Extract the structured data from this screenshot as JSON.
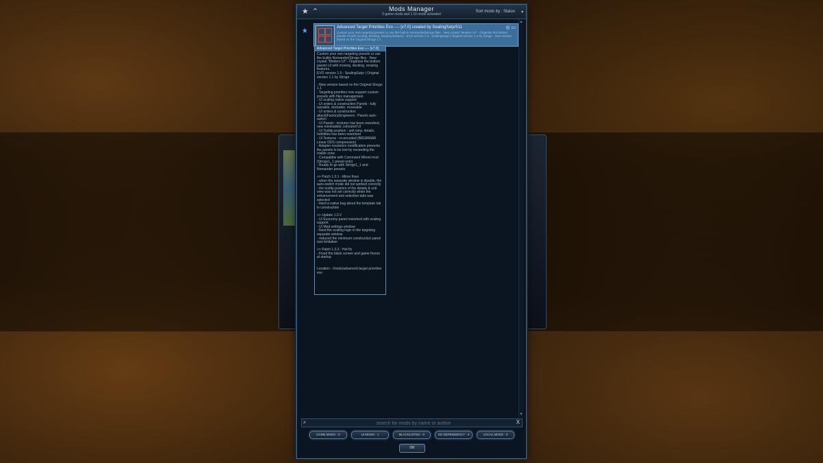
{
  "header": {
    "title": "Mods Manager",
    "subtitle": "0 game mods and 1 UI mods activated",
    "sort_label": "Sort mods by : Status",
    "sort_arrow": "▾"
  },
  "icons": {
    "favorite": "★",
    "collapse": "⌃",
    "row_favorite": "★",
    "globe": "◎",
    "monitor": "▭",
    "search": "⌕",
    "clear": "X",
    "scroll_up": "▲",
    "scroll_down": "▼"
  },
  "mods": [
    {
      "name": "Advanced Target Priorities Evo ---- [v7.0] created by SealingSatyr511",
      "description": "Custom your own targeting presets or use the built-in Nomander|Strogo files - New crystal \"Modern UI\" - Organise the bottom panels UI with moving, docking, resizing features - EVO version 1.0 - SealingSatyr | Original version 1.1 by Strogo - new version based on the Original Strogo 1.1"
    }
  ],
  "tooltip": {
    "title": "Advanced Target Priorities Evo ---- [v7.0]",
    "body": "Custom your own targeting presets or use the builtin Nomander|Strogo files - New crystal \"Modern UI\" - Organise the bottom panels UI with moving, docking, resizing features.\nEVO version 1.0 - SealingSatyr | Original version 1.1 by Strogo\n\n- New version based on the Original Strogo 1.1\n- Targeting priorities now support custom presets with files management\n- UI scaling native support\n- UI orders & construction Panels : fully sizeable, dockable, moveable\n- UI orders & construction attack|Factory|Engineers : Panels auto-switch\n- UI Panels : textures has been reworked, new minimalistic colorized UI\n- UI Tooltip position : unit view, details, hotbitties has been reworked\n- UI Textures : re-encoded (B8G8R8A8 Linear DDS compression)\n- Adapter resolution modification prevents the panels to be lost by exceeding the visible zone\n- Compatible with Command Wheel mod (Strogo1_1 preset only)\n- Ready to go with Strogo1_1 and Nomander presets\n\n>> Patch 1.0.1 - Minor fixes\n- when the separate window is disable, the auto-switch mode did not worked correctly\n- the tooltip position of the details & unit view was not set correctly when the enhancement and selection tabs was selected\n- fixed a native bug about the template tab in construction\n\n>> Update 1.0.2\n- UI Economy panel reworked with scaling support\n- UI Mod settings window\n- fixed the scaling logic in the targeting separate window\n- reduced the minimum construction panel size limitation\n\n>> Patch 1.0.3 - Hot fix\n- Fixed the black screen and game freeze at startup\n\n\nLocation : /mods/advanced target priorities evo"
  },
  "search": {
    "placeholder": "search for mods by name or author",
    "value": ""
  },
  "filters": [
    "GAME MODS - 0",
    "UI MODS - 1",
    "BLACKLISTED - 0",
    "NO DEPENDENCY - 0",
    "LOCAL MODS - 0"
  ],
  "ok_label": "OK",
  "colors": {
    "selected_row": "#3c6e9c",
    "accent": "#4fa3e6",
    "panel_bg": "#0b1522"
  }
}
